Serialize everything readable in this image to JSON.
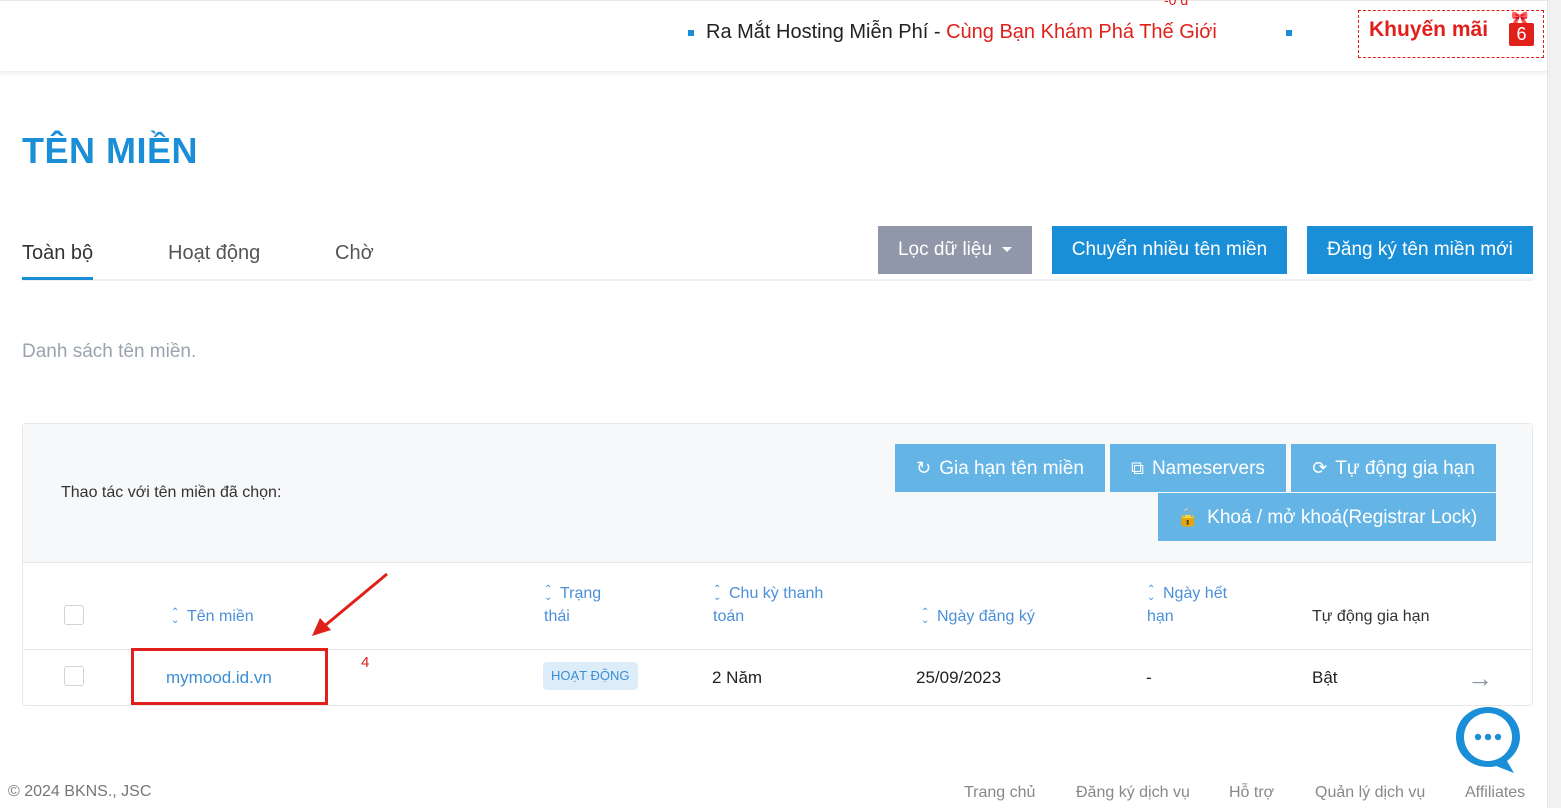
{
  "header": {
    "cutoff_text": "-0 đ",
    "marquee_plain": "Ra Mắt Hosting Miễn Phí - ",
    "marquee_red": "Cùng Bạn Khám Phá Thế Giới",
    "promo_label": "Khuyến mãi",
    "promo_count": "6",
    "promo_icon": "gift-icon"
  },
  "page": {
    "title": "TÊN MIỀN",
    "subtitle": "Danh sách tên miền."
  },
  "tabs": [
    {
      "label": "Toàn bộ",
      "active": true
    },
    {
      "label": "Hoạt động",
      "active": false
    },
    {
      "label": "Chờ",
      "active": false
    }
  ],
  "actions": {
    "filter_label": "Lọc dữ liệu",
    "transfer_label": "Chuyển nhiều tên miền",
    "register_label": "Đăng ký tên miền mới"
  },
  "toolbar": {
    "label": "Thao tác với tên miền đã chọn:",
    "renew_label": "Gia hạn tên miền",
    "nameservers_label": "Nameservers",
    "autorenew_label": "Tự động gia hạn",
    "lock_label": "Khoá / mở khoá(Registrar Lock)"
  },
  "table": {
    "columns": {
      "domain": "Tên miền",
      "status_l1": "Trạng",
      "status_l2": "thái",
      "cycle_l1": "Chu kỳ thanh",
      "cycle_l2": "toán",
      "reg_date": "Ngày đăng ký",
      "expiry_l1": "Ngày hết",
      "expiry_l2": "hạn",
      "auto_renew": "Tự động gia hạn"
    },
    "rows": [
      {
        "domain": "mymood.id.vn",
        "status": "HOẠT ĐỘNG",
        "cycle": "2 Năm",
        "reg_date": "25/09/2023",
        "expiry": "-",
        "auto_renew": "Bật"
      }
    ]
  },
  "annotation": {
    "number": "4",
    "color": "#e0201b"
  },
  "footer": {
    "copyright": "© 2024 BKNS., JSC",
    "links": [
      "Trang chủ",
      "Đăng ký dịch vụ",
      "Hỗ trợ",
      "Quản lý dịch vụ",
      "Affiliates"
    ]
  },
  "colors": {
    "primary": "#1a8fd8",
    "secondary_button": "#64b5e6",
    "filter_button": "#8f97a8",
    "accent_red": "#e0201b"
  }
}
